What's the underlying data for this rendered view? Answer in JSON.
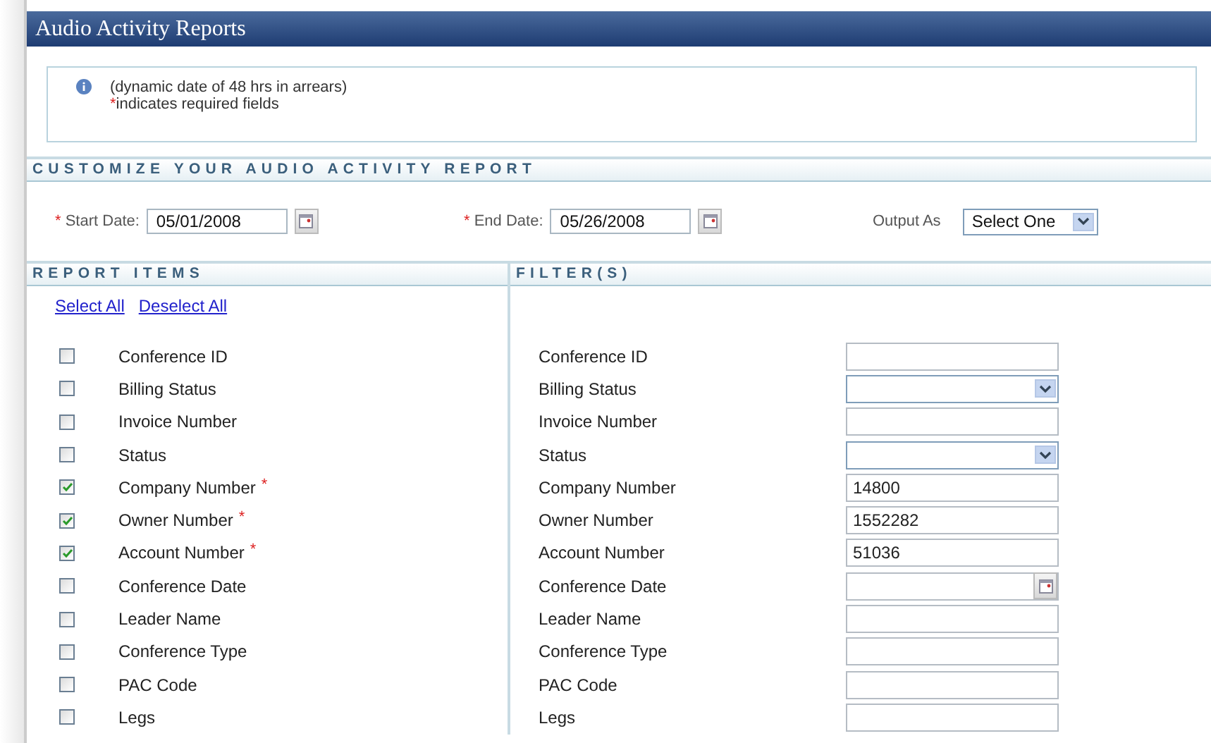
{
  "title": "Audio Activity Reports",
  "info": {
    "note": "(dynamic date of 48 hrs in arrears)",
    "required_mark": "*",
    "required_text": "indicates required fields"
  },
  "customize": {
    "heading": "CUSTOMIZE YOUR AUDIO ACTIVITY REPORT",
    "start_date": {
      "mark": "*",
      "label": "Start Date:",
      "value": "05/01/2008"
    },
    "end_date": {
      "mark": "*",
      "label": "End Date:",
      "value": "05/26/2008"
    },
    "output": {
      "label": "Output As",
      "value": "Select One"
    }
  },
  "report_items": {
    "heading": "REPORT ITEMS",
    "select_all": "Select All",
    "deselect_all": "Deselect All"
  },
  "filters": {
    "heading": "FILTER(S)"
  },
  "rows": [
    {
      "item": "Conference ID",
      "checked": false,
      "filter": "Conference ID",
      "kind": "text"
    },
    {
      "item": "Billing Status",
      "checked": false,
      "filter": "Billing Status",
      "kind": "select"
    },
    {
      "item": "Invoice Number",
      "checked": false,
      "filter": "Invoice Number",
      "kind": "text"
    },
    {
      "item": "Status",
      "checked": false,
      "filter": "Status",
      "kind": "select"
    },
    {
      "item": "Company Number",
      "required": "*",
      "checked": true,
      "filter": "Company Number",
      "kind": "text",
      "value": "14800"
    },
    {
      "item": "Owner Number",
      "required": "*",
      "checked": true,
      "filter": "Owner Number",
      "kind": "text",
      "value": "1552282"
    },
    {
      "item": "Account Number",
      "required": "*",
      "checked": true,
      "filter": "Account Number",
      "kind": "text",
      "value": "51036"
    },
    {
      "item": "Conference Date",
      "checked": false,
      "filter": "Conference Date",
      "kind": "date"
    },
    {
      "item": "Leader Name",
      "checked": false,
      "filter": "Leader Name",
      "kind": "text"
    },
    {
      "item": "Conference Type",
      "checked": false,
      "filter": "Conference Type",
      "kind": "text"
    },
    {
      "item": "PAC Code",
      "checked": false,
      "filter": "PAC Code",
      "kind": "text"
    },
    {
      "item": "Legs",
      "checked": false,
      "filter": "Legs",
      "kind": "text"
    }
  ]
}
